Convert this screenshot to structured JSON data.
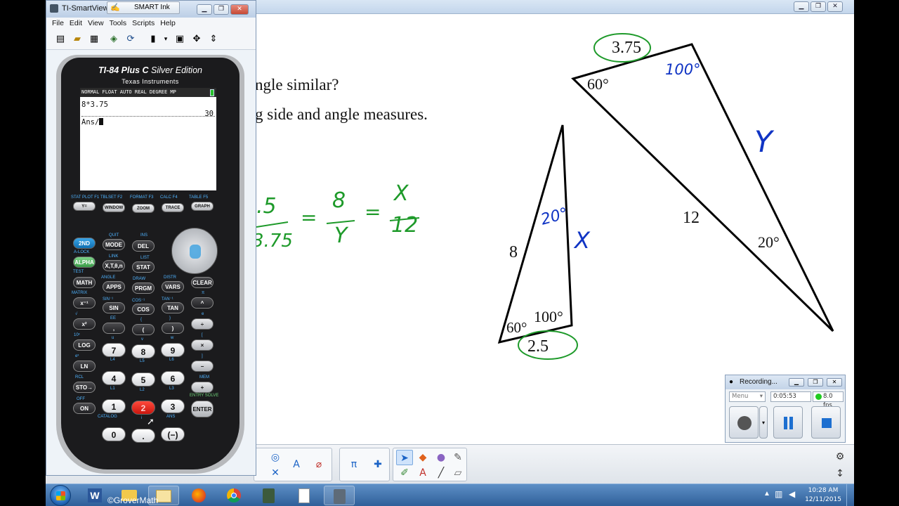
{
  "notebook": {
    "question_line1": "ngle similar?",
    "question_line2": "g side and angle measures.",
    "triangle_large": {
      "side_top": "3.75",
      "side_long": "12",
      "angle_top_left": "60°",
      "angle_bottom_right": "20°",
      "ink_angle": "100°",
      "ink_side": "Y"
    },
    "triangle_small": {
      "side_left": "8",
      "side_bottom": "2.5",
      "angle_bottom_left": "60°",
      "angle_bottom_right": "100°",
      "ink_angle": "20°",
      "ink_side": "X"
    },
    "proportion_ink": {
      "frac1_top": ".5",
      "frac1_bottom": "3.75",
      "frac2_top": "8",
      "frac2_bottom": "Y",
      "frac3_top": "X",
      "frac3_bottom": "12",
      "equals": "="
    },
    "toolbar_icons": [
      "pi-icon",
      "puzzle-icon",
      "select-arrow-icon",
      "pens-icon",
      "text-icon",
      "line-icon",
      "eraser-icon",
      "shape-icon",
      "fill-icon",
      "settings-icon",
      "move-icon"
    ]
  },
  "ti_smartview": {
    "title": "TI-SmartView™",
    "smart_ink_label": "SMART Ink",
    "menu": [
      "File",
      "Edit",
      "View",
      "Tools",
      "Scripts",
      "Help"
    ],
    "calc_brand_bold": "TI-84 Plus C",
    "calc_brand_thin": "Silver Edition",
    "calc_maker": "Texas Instruments",
    "screen": {
      "status": "NORMAL FLOAT AUTO REAL DEGREE MP",
      "line1_input": "8*3.75",
      "line1_result": "30",
      "line2_input": "Ans/"
    },
    "fn_keys": [
      {
        "top": "STAT PLOT F1",
        "label": "Y="
      },
      {
        "top": "TBLSET F2",
        "label": "WINDOW"
      },
      {
        "top": "FORMAT F3",
        "label": "ZOOM"
      },
      {
        "top": "CALC F4",
        "label": "TRACE"
      },
      {
        "top": "TABLE F5",
        "label": "GRAPH"
      }
    ],
    "keys": {
      "second": "2ND",
      "mode": "MODE",
      "del": "DEL",
      "alpha": "ALPHA",
      "xt": "X,T,θ,n",
      "stat": "STAT",
      "math": "MATH",
      "apps": "APPS",
      "prgm": "PRGM",
      "vars": "VARS",
      "clear": "CLEAR",
      "inv": "x⁻¹",
      "sin": "SIN",
      "cos": "COS",
      "tan": "TAN",
      "pow": "^",
      "sq": "x²",
      "comma": ",",
      "lparen": "(",
      "rparen": ")",
      "div": "÷",
      "log": "LOG",
      "seven": "7",
      "eight": "8",
      "nine": "9",
      "mul": "×",
      "ln": "LN",
      "four": "4",
      "five": "5",
      "six": "6",
      "minus": "−",
      "sto": "STO→",
      "one": "1",
      "two": "2",
      "three": "3",
      "plus": "+",
      "on": "ON",
      "zero": "0",
      "dot": ".",
      "neg": "(−)",
      "enter": "ENTER"
    },
    "sublabels": {
      "quit": "QUIT",
      "ins": "INS",
      "alock": "A-LOCK",
      "link": "LINK",
      "list": "LIST",
      "test": "TEST",
      "angle": "ANGLE",
      "draw": "DRAW",
      "distr": "DISTR",
      "matrix": "MATRIX",
      "sin_inv": "SIN⁻¹",
      "cos_inv": "COS⁻¹",
      "tan_inv": "TAN⁻¹",
      "pi": "π",
      "sqrt": "√",
      "ee": "EE",
      "brace_l": "{",
      "brace_r": "}",
      "e": "e",
      "ten_x": "10ˣ",
      "u": "u",
      "v": "v",
      "w": "w",
      "bracket_l": "[",
      "ex": "eˣ",
      "l4": "L4",
      "l5": "L5",
      "l6": "L6",
      "bracket_r": "]",
      "rcl": "RCL",
      "l1": "L1",
      "l2": "L2",
      "l3": "L3",
      "mem": "MEM",
      "off": "OFF",
      "catalog": "CATALOG",
      "i": "i",
      "ans": "ANS",
      "entry_solve": "ENTRY SOLVE"
    }
  },
  "recording": {
    "title": "Recording...",
    "menu_label": "Menu",
    "elapsed": "0:05:53",
    "fps": "8.0 fps",
    "status_color": "#22cc22"
  },
  "taskbar": {
    "watermark": "©GroverMath",
    "time": "10:28 AM",
    "date": "12/11/2015",
    "items": [
      "word-icon",
      "folder-icon",
      "firefox-icon",
      "chrome-icon",
      "calculator-app-icon",
      "document-icon",
      "smartview-icon"
    ]
  }
}
